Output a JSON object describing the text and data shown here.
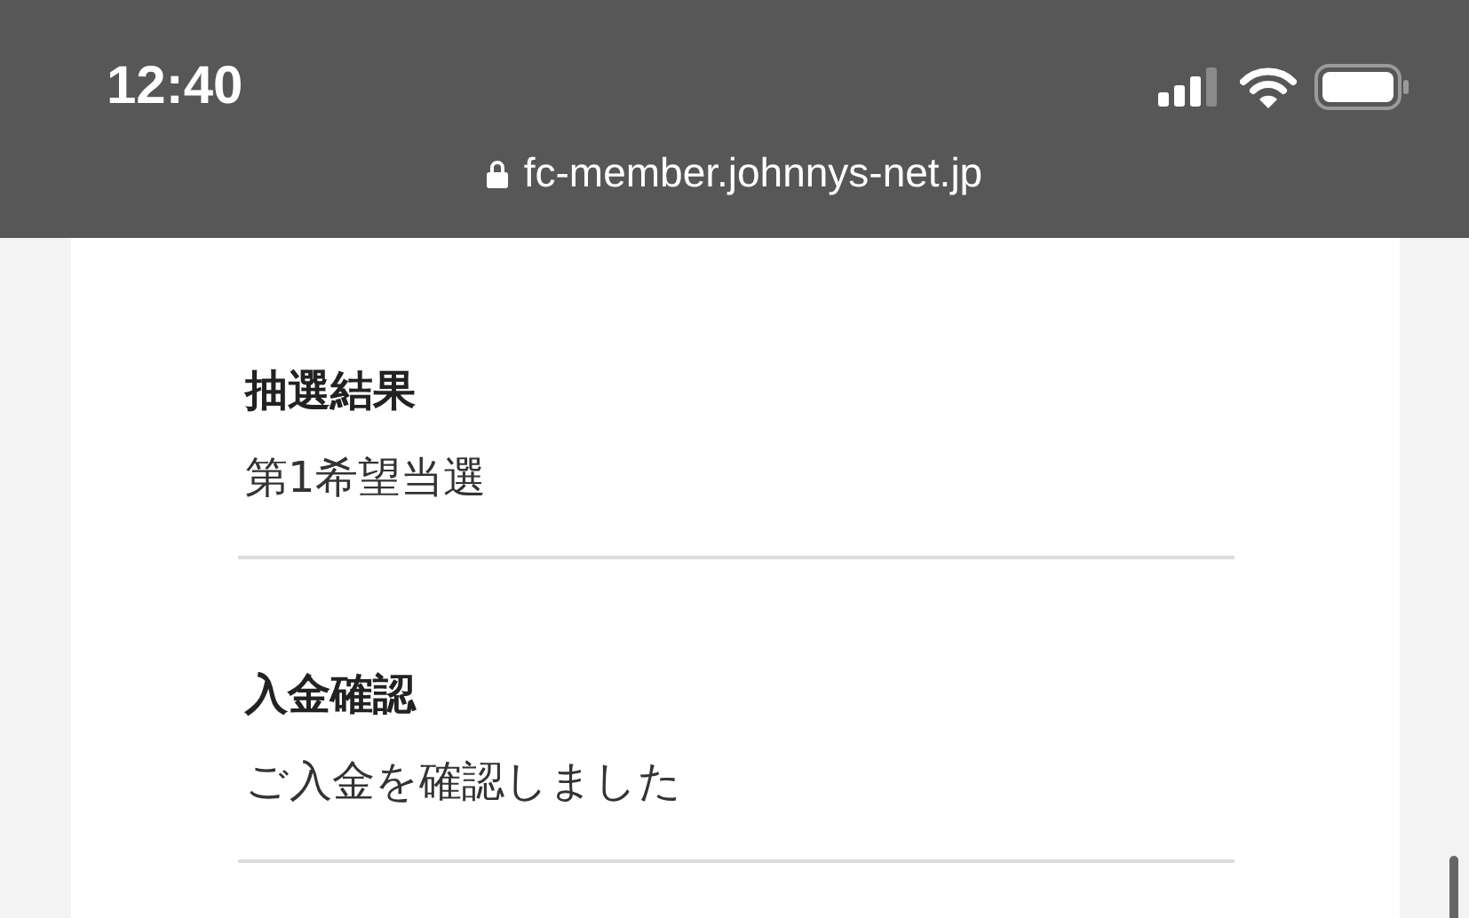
{
  "status_bar": {
    "time": "12:40"
  },
  "address_bar": {
    "url": "fc-member.johnnys-net.jp"
  },
  "sections": [
    {
      "heading": "抽選結果",
      "value": "第1希望当選"
    },
    {
      "heading": "入金確認",
      "value": "ご入金を確認しました"
    }
  ]
}
